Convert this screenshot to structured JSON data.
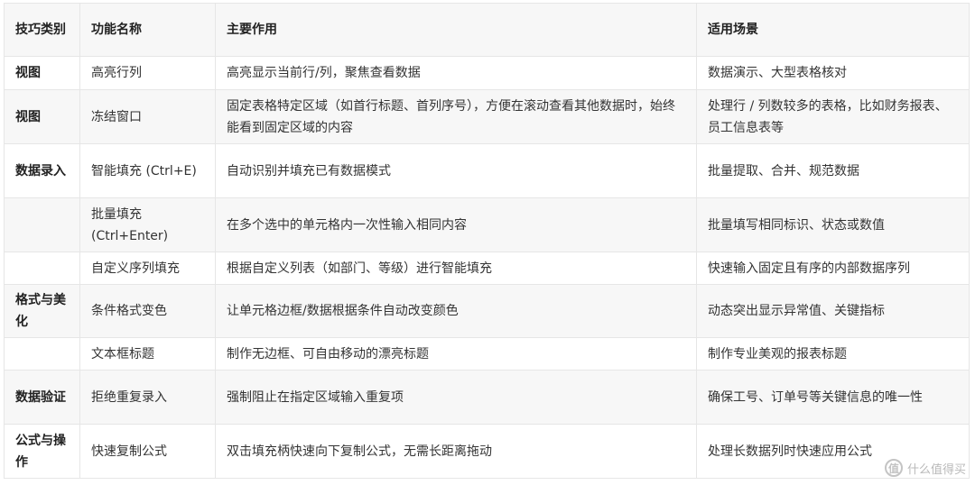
{
  "table": {
    "headers": [
      "技巧类别",
      "功能名称",
      "主要作用",
      "适用场景"
    ],
    "rows": [
      {
        "category": "视图",
        "feature": "高亮行列",
        "purpose": "高亮显示当前行/列，聚焦查看数据",
        "scenario": "数据演示、大型表格核对"
      },
      {
        "category": "视图",
        "feature": "冻结窗口",
        "purpose": "固定表格特定区域（如首行标题、首列序号），方便在滚动查看其他数据时，始终能看到固定区域的内容",
        "scenario": "处理行 / 列数较多的表格，比如财务报表、员工信息表等"
      },
      {
        "category": "数据录入",
        "feature": "智能填充 (Ctrl+E)",
        "purpose": "自动识别并填充已有数据模式",
        "scenario": "批量提取、合并、规范数据"
      },
      {
        "category": "",
        "feature": "批量填充 (Ctrl+Enter)",
        "purpose": "在多个选中的单元格内一次性输入相同内容",
        "scenario": "批量填写相同标识、状态或数值"
      },
      {
        "category": "",
        "feature": "自定义序列填充",
        "purpose": "根据自定义列表（如部门、等级）进行智能填充",
        "scenario": "快速输入固定且有序的内部数据序列"
      },
      {
        "category": "格式与美化",
        "feature": "条件格式变色",
        "purpose": "让单元格边框/数据根据条件自动改变颜色",
        "scenario": "动态突出显示异常值、关键指标"
      },
      {
        "category": "",
        "feature": "文本框标题",
        "purpose": "制作无边框、可自由移动的漂亮标题",
        "scenario": "制作专业美观的报表标题"
      },
      {
        "category": "数据验证",
        "feature": "拒绝重复录入",
        "purpose": "强制阻止在指定区域输入重复项",
        "scenario": "确保工号、订单号等关键信息的唯一性"
      },
      {
        "category": "公式与操作",
        "feature": "快速复制公式",
        "purpose": "双击填充柄快速向下复制公式，无需长距离拖动",
        "scenario": "处理长数据列时快速应用公式"
      }
    ]
  },
  "watermark": {
    "icon": "值",
    "text": "什么值得买"
  }
}
